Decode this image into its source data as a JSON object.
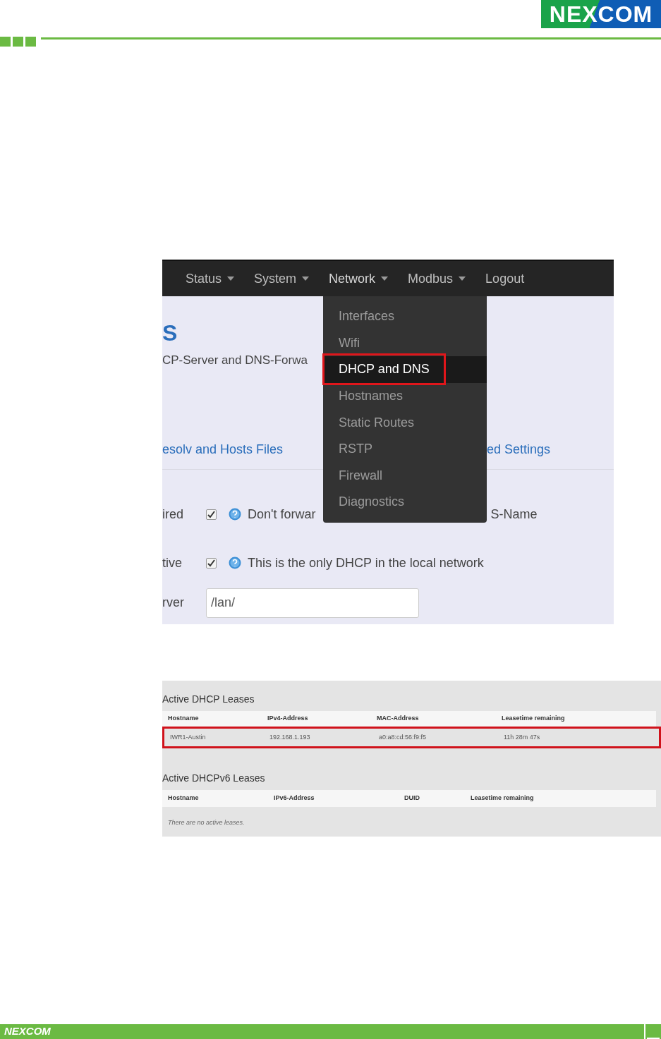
{
  "header": {
    "logo": "NEXCOM"
  },
  "screenshot_1": {
    "nav": [
      {
        "label": "Status",
        "has_menu": true,
        "selected": false
      },
      {
        "label": "System",
        "has_menu": true,
        "selected": false
      },
      {
        "label": "Network",
        "has_menu": true,
        "selected": true
      },
      {
        "label": "Modbus",
        "has_menu": true,
        "selected": false
      },
      {
        "label": "Logout",
        "has_menu": false,
        "selected": false
      }
    ],
    "menu": [
      {
        "label": "Interfaces",
        "selected": false
      },
      {
        "label": "Wifi",
        "selected": false
      },
      {
        "label": "DHCP and DNS",
        "selected": true
      },
      {
        "label": "Hostnames",
        "selected": false
      },
      {
        "label": "Static Routes",
        "selected": false
      },
      {
        "label": "RSTP",
        "selected": false
      },
      {
        "label": "Firewall",
        "selected": false
      },
      {
        "label": "Diagnostics",
        "selected": false
      }
    ],
    "title": "S",
    "description": "CP-Server and DNS-Forwa",
    "tabs": [
      "esolv and Hosts Files",
      "ed Settings"
    ],
    "options": [
      {
        "label": "ired",
        "checked": true,
        "text": "Don't forwar",
        "text_tail": "S-Name"
      },
      {
        "label": "tive",
        "checked": true,
        "text": "This is the only DHCP in the local network"
      }
    ],
    "field": {
      "label": "rver",
      "value": "/lan/"
    }
  },
  "screenshot_2": {
    "leases": {
      "title": "Active DHCP Leases",
      "columns": [
        "Hostname",
        "IPv4-Address",
        "MAC-Address",
        "Leasetime remaining"
      ],
      "rows": [
        {
          "cells": [
            "IWR1-Austin",
            "192.168.1.193",
            "a0:a8:cd:56:f9:f5",
            "11h 28m 47s"
          ],
          "highlighted": true
        }
      ]
    },
    "leases_v6": {
      "title": "Active DHCPv6 Leases",
      "columns": [
        "Hostname",
        "IPv6-Address",
        "DUID",
        "Leasetime remaining"
      ],
      "empty": "There are no active leases."
    }
  },
  "footer": {
    "logo": "NEXCOM"
  }
}
